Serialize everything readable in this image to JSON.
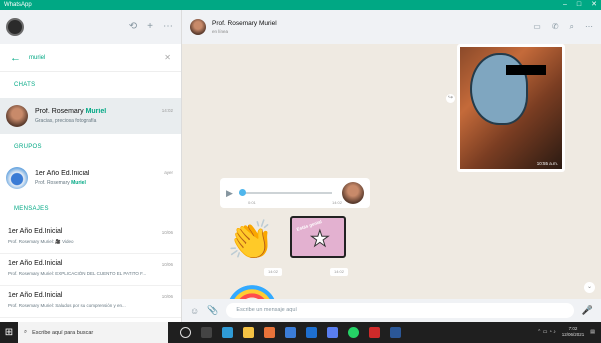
{
  "window": {
    "title": "WhatsApp",
    "controls": [
      "–",
      "□",
      "✕"
    ]
  },
  "sidebar": {
    "header_icons": [
      "⟲",
      "+",
      "⋯"
    ],
    "search": {
      "value": "muriel"
    },
    "sections": {
      "chats": "CHATS",
      "groups": "GRUPOS",
      "messages": "MENSAJES"
    },
    "chats": [
      {
        "name_prefix": "Prof. Rosemary ",
        "name_match": "Muriel",
        "sub": "Gracias, preciosa fotografía",
        "time": "14:02"
      }
    ],
    "groups": [
      {
        "name": "1er Año Ed.Inicial",
        "sub_prefix": "Prof. Rosemary ",
        "sub_match": "Muriel",
        "time": "ayer"
      }
    ],
    "messages": [
      {
        "name": "1er Año Ed.Inicial",
        "sub": "Prof. Rosemary Muriel: 🎥 Video",
        "time": "10/06"
      },
      {
        "name": "1er Año Ed.Inicial",
        "sub": "Prof. Rosemary Muriel: EXPLICACIÓN DEL CUENTO EL PATITO F...",
        "time": "10/06"
      },
      {
        "name": "1er Año Ed.Inicial",
        "sub": "Prof. Rosemary Muriel: Saludos por su comprensión y en...",
        "time": "10/06"
      }
    ]
  },
  "chat": {
    "contact": "Prof. Rosemary Muriel",
    "status": "en línea",
    "header_icons": [
      "▭",
      "✆",
      "⌕",
      "⋯"
    ],
    "photo_time": "10:55 a.m.",
    "audio": {
      "elapsed": "0:01",
      "time": "14:02"
    },
    "sticker_times": [
      "14:02",
      "14:02"
    ],
    "sticker2_text": "Estás genial",
    "composer_placeholder": "Escribe un mensaje aquí"
  },
  "taskbar": {
    "search_placeholder": "Escribe aquí para buscar",
    "time": "7:02",
    "date": "12/06/2021"
  }
}
